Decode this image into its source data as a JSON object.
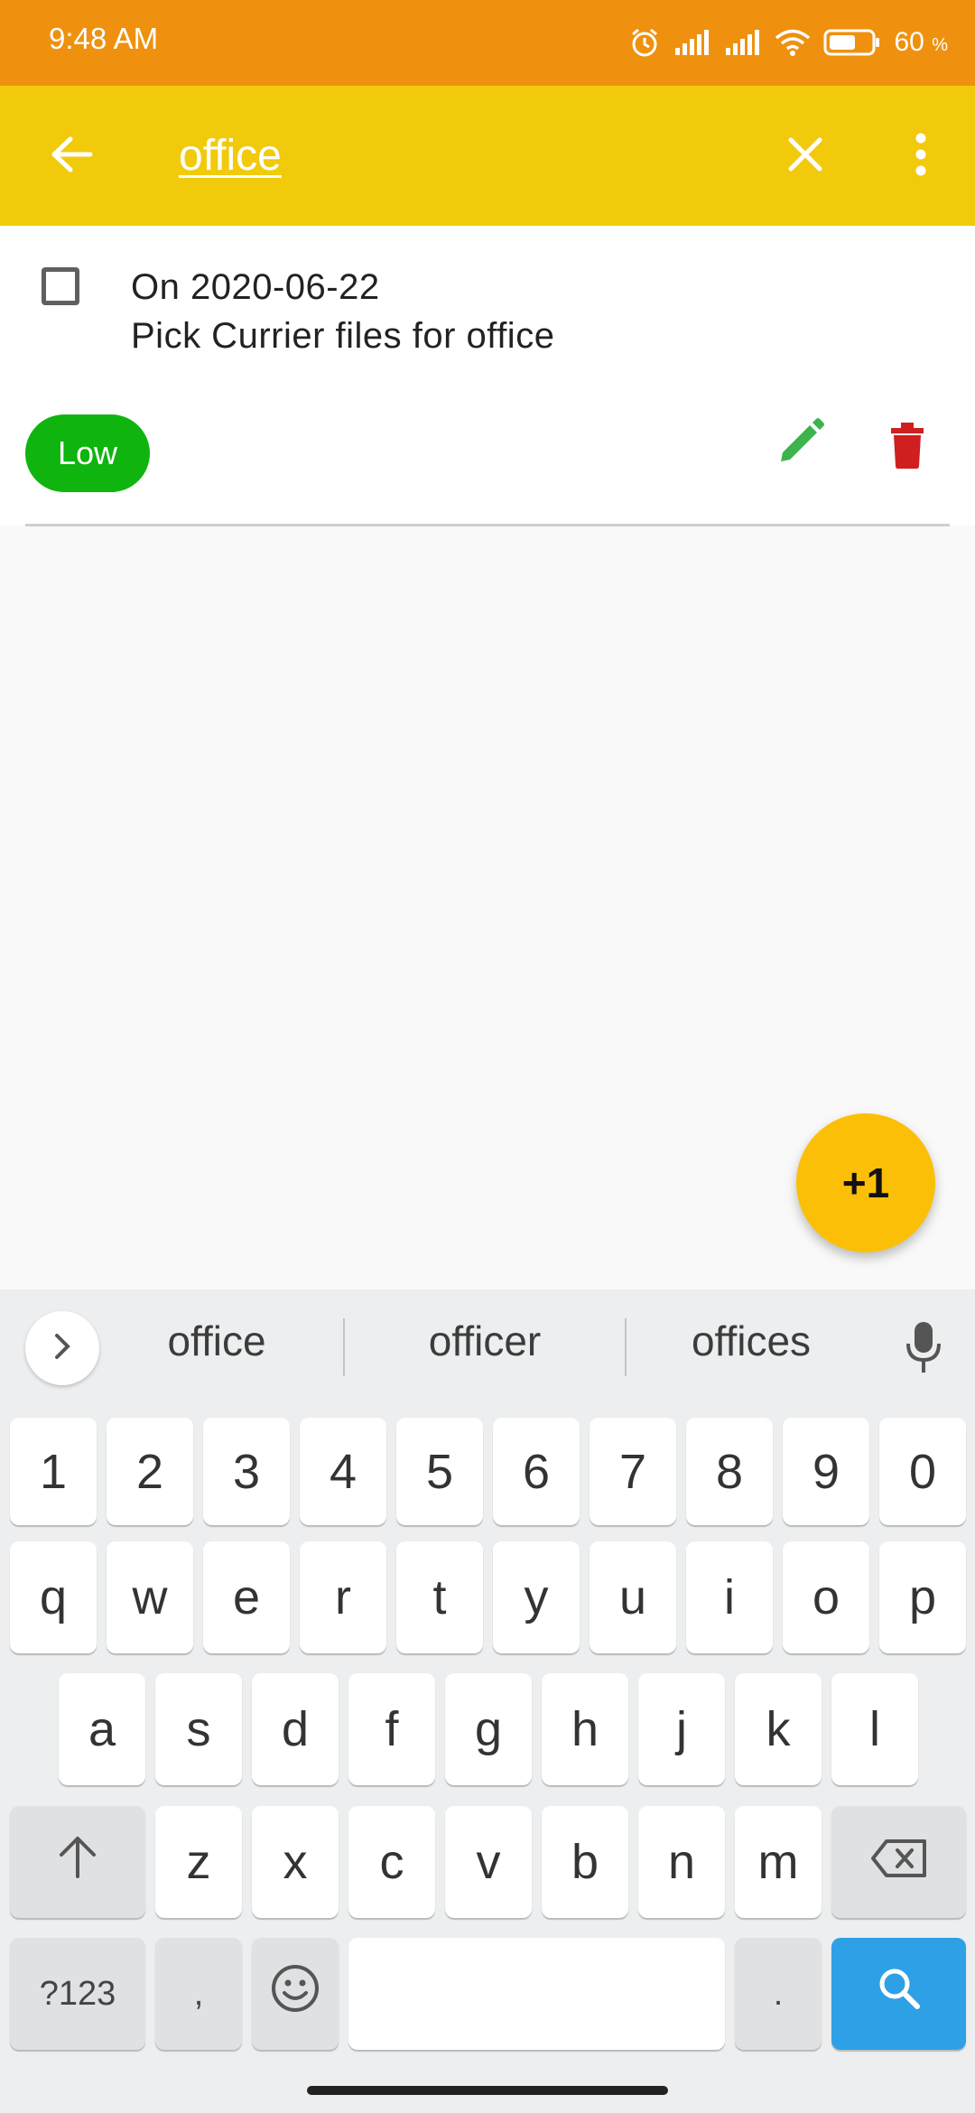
{
  "status_bar": {
    "time": "9:48 AM",
    "battery_percent": "60",
    "battery_unit": "%",
    "icons": [
      "alarm-icon",
      "signal-icon",
      "signal-icon",
      "wifi-icon",
      "battery-icon"
    ]
  },
  "app_bar": {
    "search_value": "office",
    "icons": {
      "back": "arrow-left-icon",
      "clear": "close-icon",
      "more": "more-vert-icon"
    }
  },
  "task": {
    "checked": false,
    "date_line": "On 2020-06-22",
    "title": "Pick Currier files for office",
    "priority": "Low",
    "colors": {
      "priority": "#0fb40f",
      "edit": "#3cb44b",
      "delete": "#d01f1f"
    }
  },
  "fab": {
    "label": "+1",
    "color": "#fcbf07"
  },
  "keyboard": {
    "suggestions": [
      "office",
      "officer",
      "offices"
    ],
    "row_numbers": [
      "1",
      "2",
      "3",
      "4",
      "5",
      "6",
      "7",
      "8",
      "9",
      "0"
    ],
    "row1": [
      "q",
      "w",
      "e",
      "r",
      "t",
      "y",
      "u",
      "i",
      "o",
      "p"
    ],
    "row2": [
      "a",
      "s",
      "d",
      "f",
      "g",
      "h",
      "j",
      "k",
      "l"
    ],
    "row3": [
      "z",
      "x",
      "c",
      "v",
      "b",
      "n",
      "m"
    ],
    "symbols_key": "?123",
    "comma_key": ",",
    "period_key": ".",
    "accent": "#2ea0e6"
  }
}
